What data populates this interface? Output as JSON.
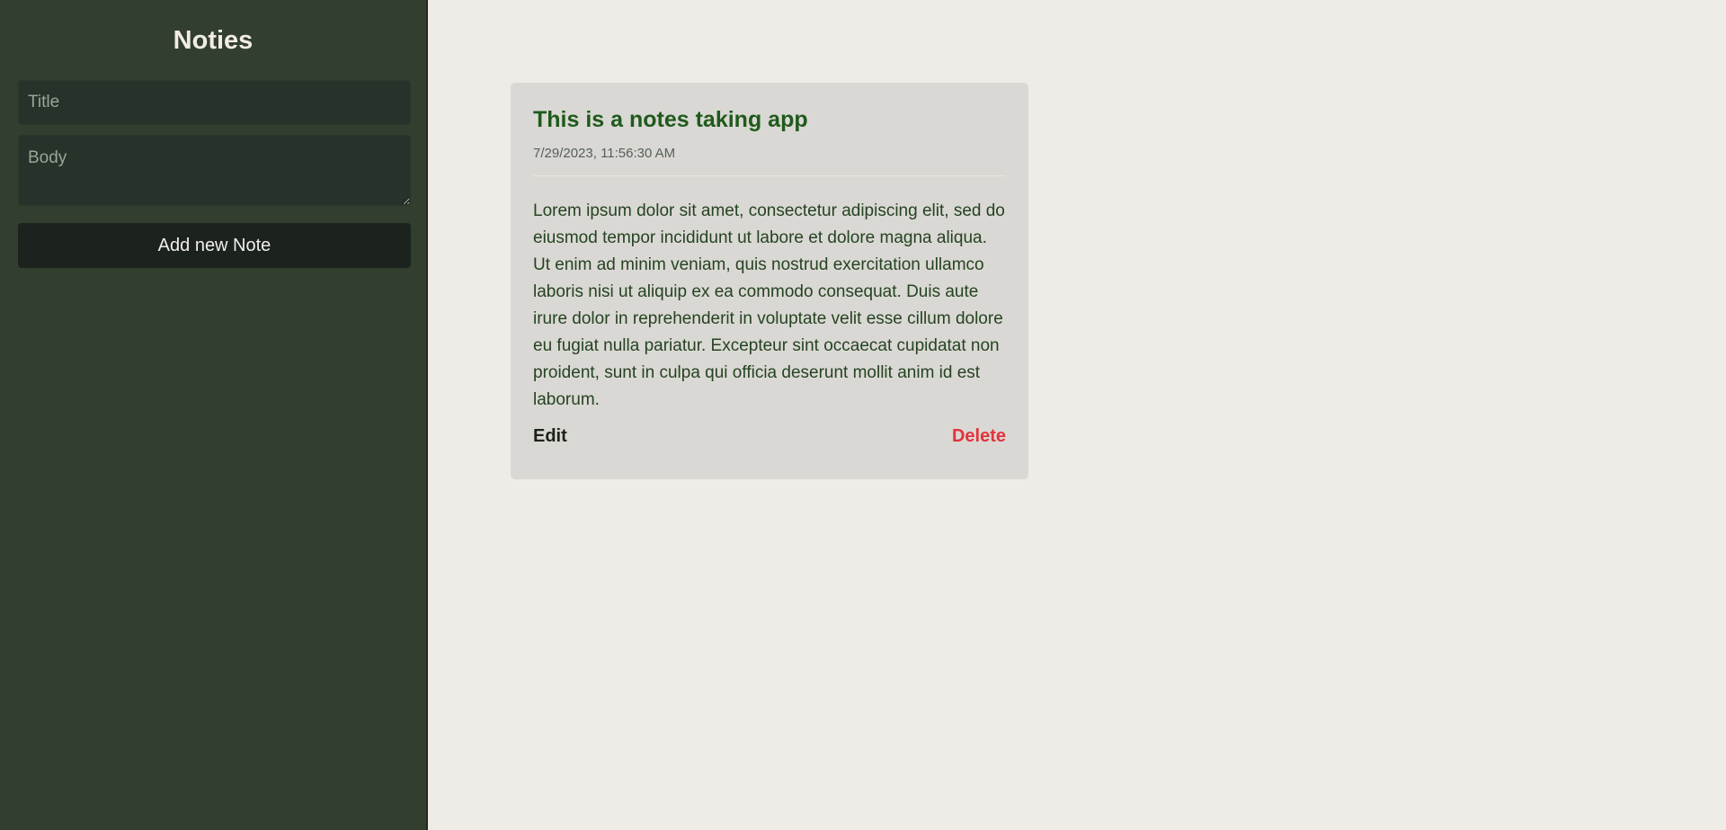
{
  "sidebar": {
    "app_title": "Noties",
    "title_input": {
      "placeholder": "Title",
      "value": ""
    },
    "body_input": {
      "placeholder": "Body",
      "value": ""
    },
    "add_button_label": "Add new Note"
  },
  "notes": [
    {
      "title": "This is a notes taking app",
      "date": "7/29/2023, 11:56:30 AM",
      "body": "Lorem ipsum dolor sit amet, consectetur adipiscing elit, sed do eiusmod tempor incididunt ut labore et dolore magna aliqua. Ut enim ad minim veniam, quis nostrud exercitation ullamco laboris nisi ut aliquip ex ea commodo consequat. Duis aute irure dolor in reprehenderit in voluptate velit esse cillum dolore eu fugiat nulla pariatur. Excepteur sint occaecat cupidatat non proident, sunt in culpa qui officia deserunt mollit anim id est laborum.",
      "edit_label": "Edit",
      "delete_label": "Delete"
    }
  ],
  "colors": {
    "sidebar_bg": "#323f2e",
    "main_bg": "#efece7",
    "card_bg": "#dad8d4",
    "note_title": "#1f5a1c",
    "delete": "#e0343b"
  }
}
